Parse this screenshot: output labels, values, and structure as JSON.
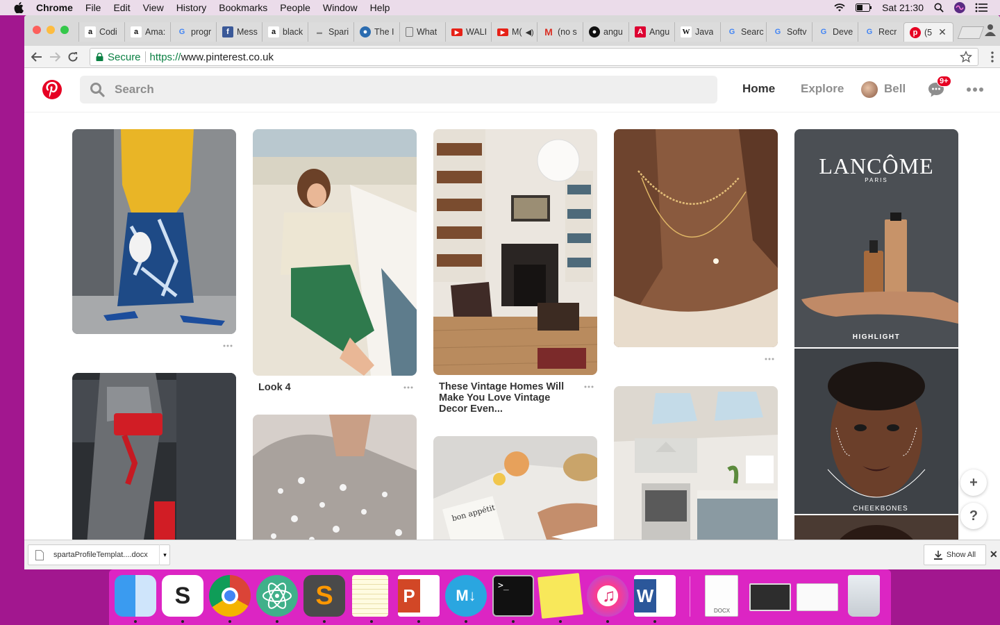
{
  "menubar": {
    "app_name": "Chrome",
    "menus": [
      "File",
      "Edit",
      "View",
      "History",
      "Bookmarks",
      "People",
      "Window",
      "Help"
    ],
    "clock": "Sat 21:30"
  },
  "tabs": [
    {
      "icon": "amazon-icon",
      "label": "Codi"
    },
    {
      "icon": "amazon-icon",
      "label": "Ama:"
    },
    {
      "icon": "google-icon",
      "label": "progr"
    },
    {
      "icon": "facebook-icon",
      "label": "Mess"
    },
    {
      "icon": "amazon-icon",
      "label": "black"
    },
    {
      "icon": "spark-icon",
      "label": "Spari"
    },
    {
      "icon": "globe-icon",
      "label": "The I"
    },
    {
      "icon": "page-icon",
      "label": "What"
    },
    {
      "icon": "youtube-icon",
      "label": "WALI"
    },
    {
      "icon": "youtube-icon",
      "label": "M("
    },
    {
      "icon": "gmail-icon",
      "label": "(no s"
    },
    {
      "icon": "github-icon",
      "label": "angu"
    },
    {
      "icon": "angular-icon",
      "label": "Angu"
    },
    {
      "icon": "wikipedia-icon",
      "label": "Java"
    },
    {
      "icon": "google-icon",
      "label": "Searc"
    },
    {
      "icon": "google-icon",
      "label": "Softv"
    },
    {
      "icon": "google-icon",
      "label": "Deve"
    },
    {
      "icon": "google-icon",
      "label": "Recr"
    },
    {
      "icon": "pinterest-icon",
      "label": "(5",
      "active": true
    }
  ],
  "address_bar": {
    "secure_label": "Secure",
    "scheme": "https://",
    "host": "www.pinterest.co.uk"
  },
  "pinterest": {
    "search_placeholder": "Search",
    "nav_home": "Home",
    "nav_explore": "Explore",
    "user_name": "Bell",
    "notification_badge": "9+",
    "brand_color": "#e60023"
  },
  "pins": {
    "look_title": "Look 4",
    "vintage_title": "These Vintage Homes Will Make You Love Vintage Decor Even...",
    "ad_brand": "LANCÔME",
    "ad_brand_sub": "PARIS",
    "ad_highlight": "HIGHLIGHT",
    "ad_cheekbones": "CHEEKBONES",
    "magazine_text": "bon appétit"
  },
  "fab": {
    "add": "+",
    "help": "?"
  },
  "download_shelf": {
    "file_name": "spartaProfileTemplat....docx",
    "show_all": "Show All"
  },
  "dock": {
    "docx_label": "DOCX",
    "apps": [
      "finder",
      "slack",
      "chrome",
      "atom",
      "sublime-text",
      "notes",
      "powerpoint",
      "markdown",
      "terminal",
      "stickies",
      "itunes",
      "word",
      "document",
      "screenshot",
      "preview",
      "trash"
    ]
  }
}
